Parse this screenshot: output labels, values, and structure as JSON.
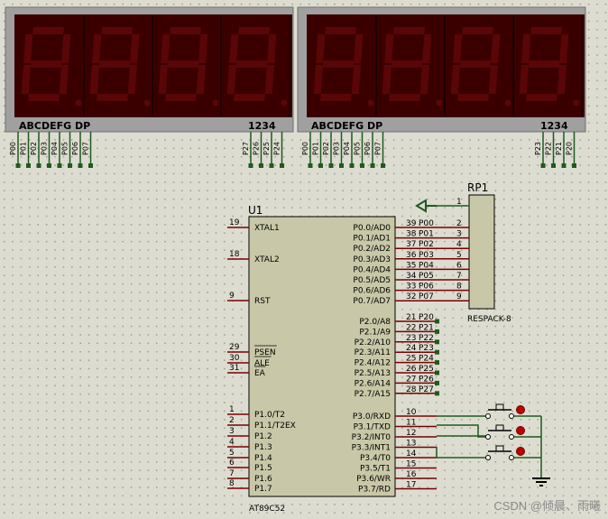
{
  "displays": [
    {
      "segment_label": "ABCDEFG DP",
      "digit_label": "1234",
      "seg_pins": [
        "P00",
        "P01",
        "P02",
        "P03",
        "P04",
        "P05",
        "P06",
        "P07"
      ],
      "dig_pins": [
        "P27",
        "P26",
        "P25",
        "P24"
      ]
    },
    {
      "segment_label": "ABCDEFG DP",
      "digit_label": "1234",
      "seg_pins": [
        "P00",
        "P01",
        "P02",
        "P03",
        "P04",
        "P05",
        "P06",
        "P07"
      ],
      "dig_pins": [
        "P23",
        "P22",
        "P21",
        "P20"
      ]
    }
  ],
  "mcu": {
    "ref": "U1",
    "part": "AT89C52",
    "left_pins": [
      {
        "num": "19",
        "name": "XTAL1"
      },
      {
        "num": "18",
        "name": "XTAL2"
      },
      {
        "num": "9",
        "name": "RST"
      },
      {
        "num": "29",
        "name": "PSEN"
      },
      {
        "num": "30",
        "name": "ALE"
      },
      {
        "num": "31",
        "name": "EA"
      },
      {
        "num": "1",
        "name": "P1.0/T2"
      },
      {
        "num": "2",
        "name": "P1.1/T2EX"
      },
      {
        "num": "3",
        "name": "P1.2"
      },
      {
        "num": "4",
        "name": "P1.3"
      },
      {
        "num": "5",
        "name": "P1.4"
      },
      {
        "num": "6",
        "name": "P1.5"
      },
      {
        "num": "7",
        "name": "P1.6"
      },
      {
        "num": "8",
        "name": "P1.7"
      }
    ],
    "right_pins": [
      {
        "num": "39",
        "name": "P0.0/AD0",
        "net": "P00"
      },
      {
        "num": "38",
        "name": "P0.1/AD1",
        "net": "P01"
      },
      {
        "num": "37",
        "name": "P0.2/AD2",
        "net": "P02"
      },
      {
        "num": "36",
        "name": "P0.3/AD3",
        "net": "P03"
      },
      {
        "num": "35",
        "name": "P0.4/AD4",
        "net": "P04"
      },
      {
        "num": "34",
        "name": "P0.5/AD5",
        "net": "P05"
      },
      {
        "num": "33",
        "name": "P0.6/AD6",
        "net": "P06"
      },
      {
        "num": "32",
        "name": "P0.7/AD7",
        "net": "P07"
      },
      {
        "num": "21",
        "name": "P2.0/A8",
        "net": "P20"
      },
      {
        "num": "22",
        "name": "P2.1/A9",
        "net": "P21"
      },
      {
        "num": "23",
        "name": "P2.2/A10",
        "net": "P22"
      },
      {
        "num": "24",
        "name": "P2.3/A11",
        "net": "P23"
      },
      {
        "num": "25",
        "name": "P2.4/A12",
        "net": "P24"
      },
      {
        "num": "26",
        "name": "P2.5/A13",
        "net": "P25"
      },
      {
        "num": "27",
        "name": "P2.6/A14",
        "net": "P26"
      },
      {
        "num": "28",
        "name": "P2.7/A15",
        "net": "P27"
      },
      {
        "num": "10",
        "name": "P3.0/RXD"
      },
      {
        "num": "11",
        "name": "P3.1/TXD"
      },
      {
        "num": "12",
        "name": "P3.2/INT0"
      },
      {
        "num": "13",
        "name": "P3.3/INT1"
      },
      {
        "num": "14",
        "name": "P3.4/T0"
      },
      {
        "num": "15",
        "name": "P3.5/T1"
      },
      {
        "num": "16",
        "name": "P3.6/WR"
      },
      {
        "num": "17",
        "name": "P3.7/RD"
      }
    ]
  },
  "respack": {
    "ref": "RP1",
    "part": "RESPACK-8",
    "pins": [
      "1",
      "2",
      "3",
      "4",
      "5",
      "6",
      "7",
      "8",
      "9"
    ]
  },
  "watermark": "CSDN @倾晨、雨曦",
  "colors": {
    "segment_dark": "#5a0606",
    "display_bg": "#3a0000",
    "display_frame": "#a0a0a0",
    "chip_fill": "#c8c8a8",
    "wire": "#1f5a1f",
    "pin": "#7a0000",
    "switch_dot": "#c00000"
  }
}
